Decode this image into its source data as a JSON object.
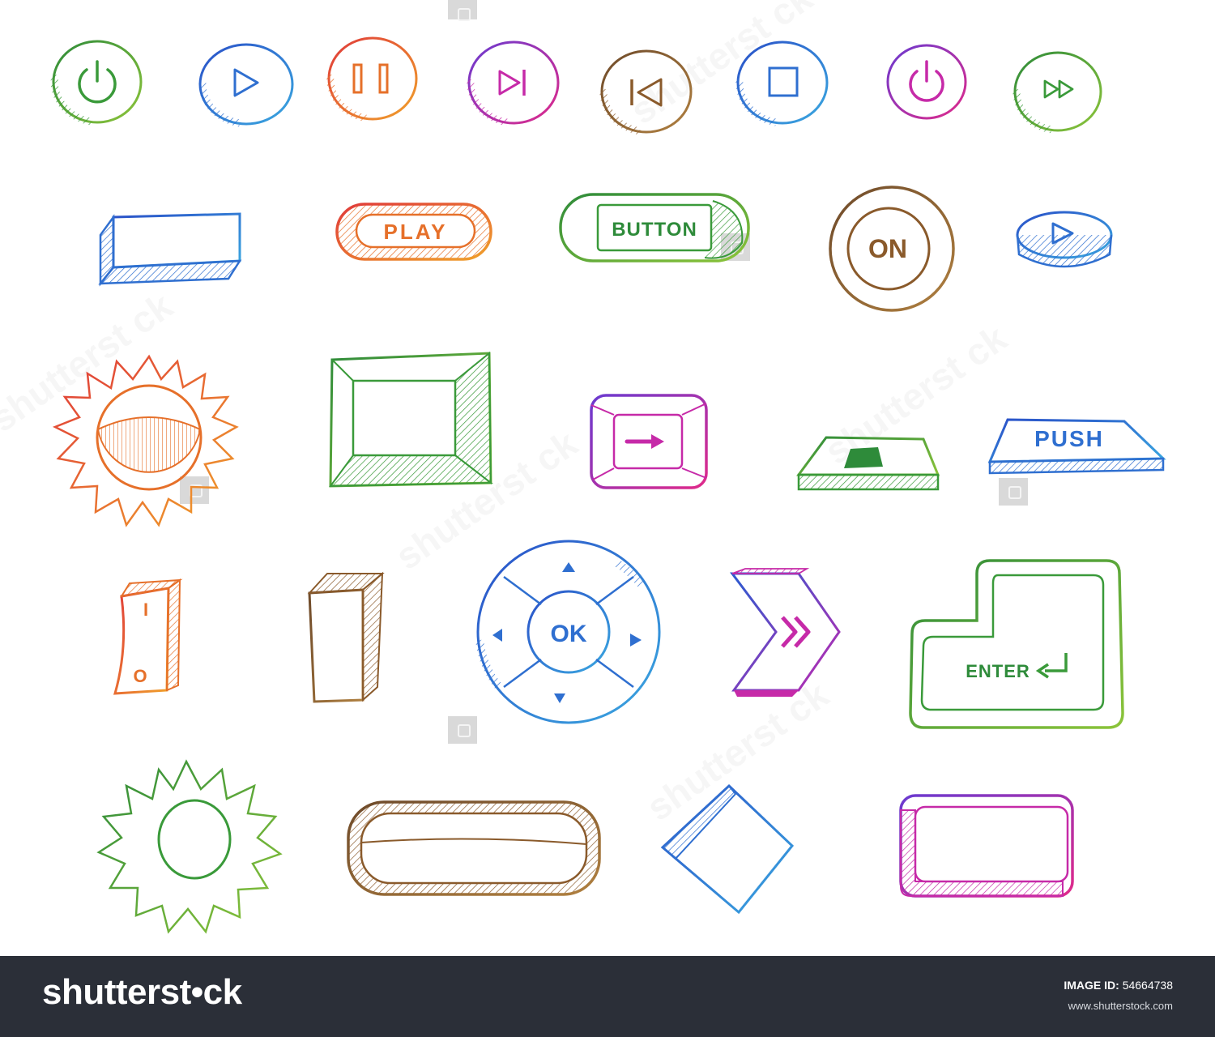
{
  "labels": {
    "play": "PLAY",
    "button": "BUTTON",
    "on": "ON",
    "push": "PUSH",
    "ok": "OK",
    "enter": "ENTER",
    "switch_on": "I",
    "switch_off": "O"
  },
  "icons": [
    "power-icon",
    "play-icon",
    "pause-icon",
    "skip-forward-icon",
    "skip-back-icon",
    "stop-icon",
    "power-icon",
    "fast-forward-icon",
    "arrow-right-icon",
    "double-chevron-right-icon",
    "enter-arrow-icon"
  ],
  "colors": {
    "green": "#3a9a3a",
    "blue": "#2f6fd0",
    "orange": "#e6702a",
    "magenta": "#c62aa8",
    "brown": "#8a5a2b",
    "purple": "#7a3cc0",
    "footer": "#2b2f38"
  },
  "watermark": {
    "text": "shutterst ck"
  },
  "footer": {
    "brand": "shutterst•ck",
    "image_id_label": "IMAGE ID:",
    "image_id": "54664738",
    "site": "www.shutterstock.com"
  }
}
